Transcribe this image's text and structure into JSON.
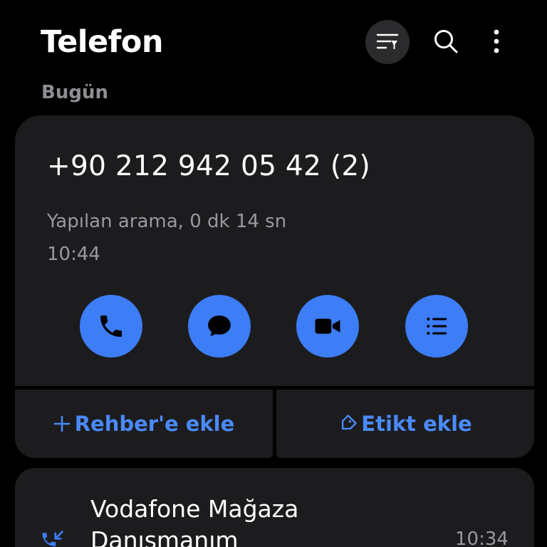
{
  "app": {
    "title": "Telefon"
  },
  "toolbar": {
    "filter_icon": "filter-list-icon",
    "search_icon": "search-icon",
    "more_icon": "more-vertical-icon"
  },
  "section": {
    "header": "Bugün"
  },
  "expanded_call": {
    "number": "+90 212 942 05 42 (2)",
    "detail": "Yapılan arama, 0 dk 14 sn",
    "time": "10:44",
    "actions": [
      {
        "name": "call",
        "icon": "phone-icon"
      },
      {
        "name": "message",
        "icon": "message-icon"
      },
      {
        "name": "video-call",
        "icon": "video-icon"
      },
      {
        "name": "details",
        "icon": "list-icon"
      }
    ],
    "add_contact_label": "Rehber'e ekle",
    "add_tag_label": "Etikt ekle"
  },
  "call_log": [
    {
      "name": "Vodafone Mağaza Danışmanım",
      "time": "10:34",
      "icon": "incoming-call-icon"
    }
  ],
  "colors": {
    "background": "#000000",
    "card": "#1c1c1e",
    "accent": "#3d7df6",
    "accent_text": "#4a8af8",
    "secondary_text": "#9a9a9e"
  }
}
